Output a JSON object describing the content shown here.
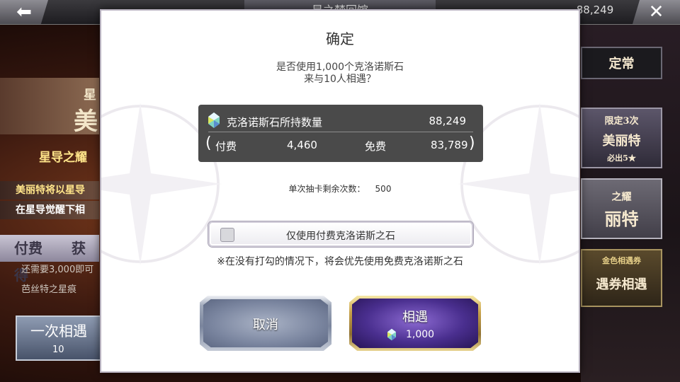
{
  "topbar": {
    "back_icon": "back-arrow-icon",
    "title": "星之梦回馆",
    "stone_count": "88,249",
    "close_icon": "close-icon"
  },
  "background_left": {
    "banner_line1": "星",
    "banner_line2": "美",
    "subtitle": "星导之耀",
    "line1": "美丽特将以星导",
    "line2": "在星导觉醒下相",
    "pay_label": "付费",
    "pay_suffix": "获得",
    "note1": "还需要3,000即可",
    "note2": "芭丝特之星痕",
    "button_label": "一次相遇",
    "button_cost": "10"
  },
  "background_right": {
    "tab_label": "定常",
    "limited_label": "限定3次",
    "limited_name": "美丽特",
    "limited_sub": "必出5★",
    "item2_top": "之耀",
    "item2_name": "丽特",
    "ticket_label": "金色相遇券",
    "ticket_name": "遇券相遇"
  },
  "dialog": {
    "title": "确定",
    "question_line1": "是否使用1,000个克洛诺斯石",
    "question_line2": "来与10人相遇？",
    "stone_label": "克洛诺斯石所持数量",
    "stone_total": "88,249",
    "paid_label": "付费",
    "paid_value": "4,460",
    "free_label": "免费",
    "free_value": "83,789",
    "remain_label": "单次抽卡剩余次数：",
    "remain_value": "500",
    "checkbox_label": "仅使用付费克洛诺斯之石",
    "checkbox_checked": false,
    "note": "※在没有打勾的情况下，将会优先使用免费克洛诺斯之石",
    "cancel_label": "取消",
    "confirm_label": "相遇",
    "confirm_cost": "1,000"
  }
}
